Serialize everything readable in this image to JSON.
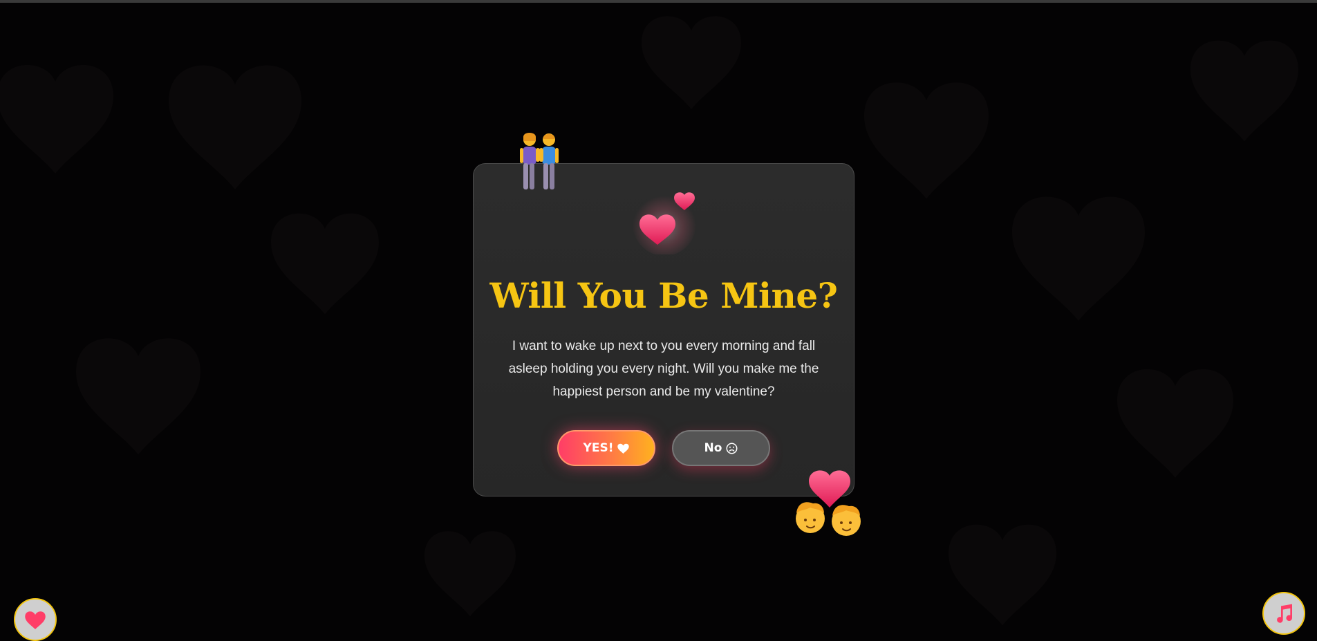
{
  "dialog": {
    "title": "Will You Be Mine?",
    "message": "I want to wake up next to you every morning and fall asleep holding you every night. Will you make me the happiest person and be my valentine?",
    "yes_label": "YES!",
    "no_label": "No"
  },
  "icons": {
    "couple": "couple-holding-hands-icon",
    "hearts": "two-hearts-icon",
    "kiss": "kiss-icon",
    "yes": "heart-icon",
    "no": "sad-face-icon",
    "fab_left": "heart-icon",
    "fab_right": "music-note-icon"
  },
  "colors": {
    "background": "#040304",
    "card": "#2a2a2a",
    "title": "#f6c513",
    "accent_pink": "#ff3d67",
    "accent_orange": "#ffb11f",
    "fab_border": "#f3c50f"
  }
}
